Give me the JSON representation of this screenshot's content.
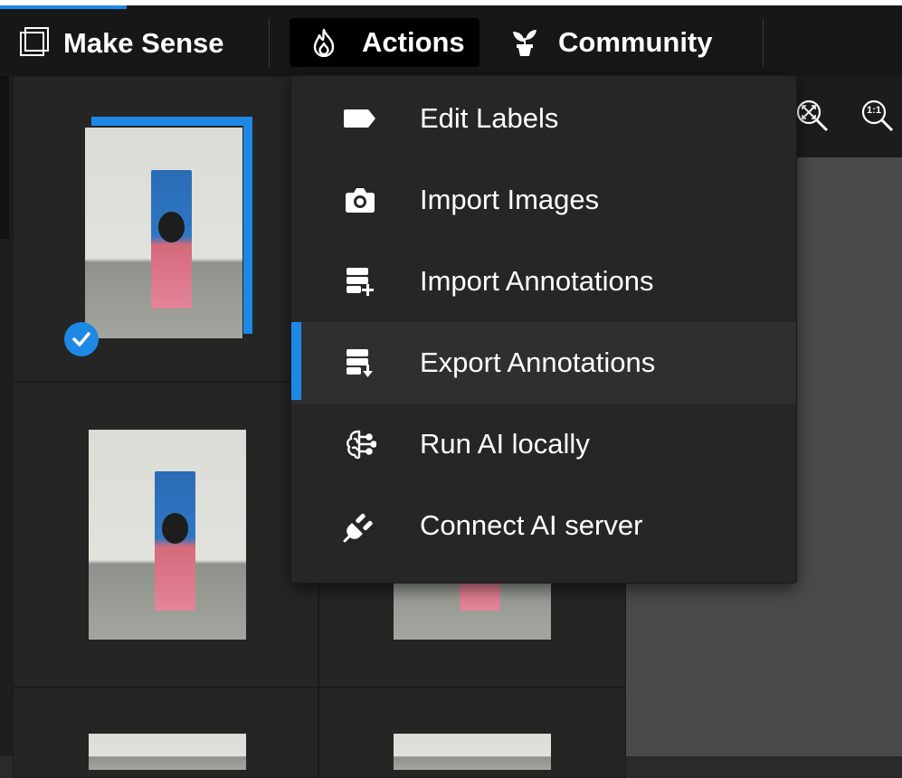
{
  "header": {
    "brand": "Make Sense",
    "nav": [
      {
        "label": "Actions",
        "icon": "flame-icon",
        "active": true
      },
      {
        "label": "Community",
        "icon": "plant-icon",
        "active": false
      }
    ]
  },
  "actions_menu": {
    "items": [
      {
        "label": "Edit Labels",
        "icon": "tag-icon"
      },
      {
        "label": "Import Images",
        "icon": "camera-icon"
      },
      {
        "label": "Import Annotations",
        "icon": "database-plus-icon"
      },
      {
        "label": "Export Annotations",
        "icon": "database-download-icon",
        "highlighted": true
      },
      {
        "label": "Run AI locally",
        "icon": "brain-icon"
      },
      {
        "label": "Connect AI server",
        "icon": "plug-icon"
      }
    ]
  },
  "toolbar": {
    "zoom_fit_icon": "zoom-fit-icon",
    "zoom_actual_label": "1:1"
  },
  "colors": {
    "accent": "#1e88e5",
    "topbar": "#171717",
    "menu": "#262626"
  }
}
